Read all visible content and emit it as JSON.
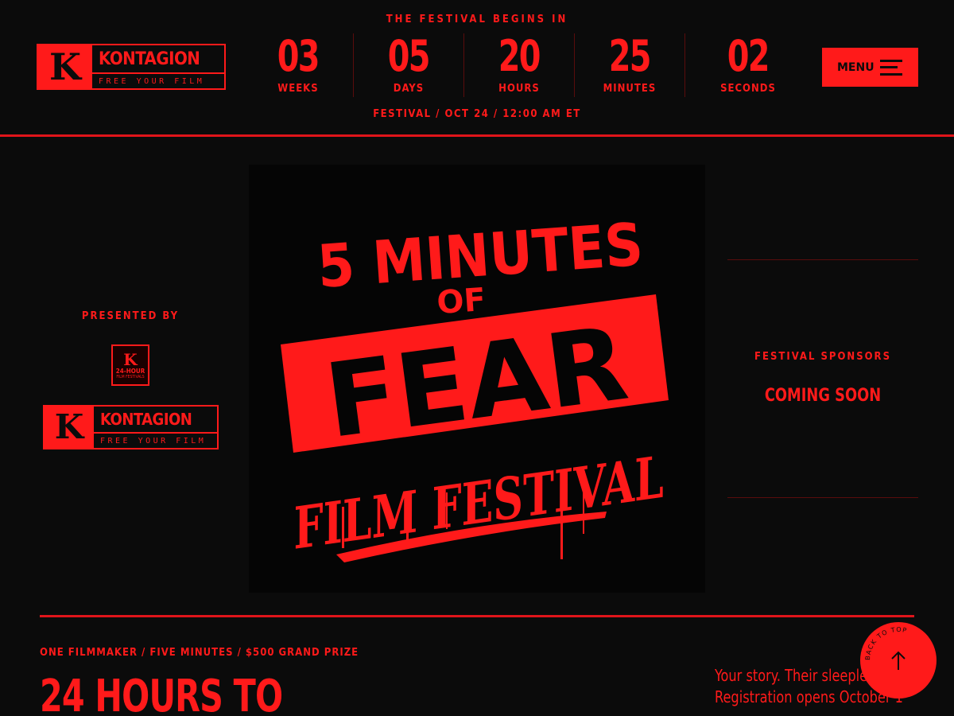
{
  "header": {
    "logo": {
      "letter": "K",
      "name": "KONTAGION",
      "tagline": "FREE YOUR FILM"
    },
    "countdown_title": "THE FESTIVAL BEGINS IN",
    "countdown": [
      {
        "value": "03",
        "label": "WEEKS"
      },
      {
        "value": "05",
        "label": "DAYS"
      },
      {
        "value": "20",
        "label": "HOURS"
      },
      {
        "value": "25",
        "label": "MINUTES"
      },
      {
        "value": "02",
        "label": "SECONDS"
      }
    ],
    "festival_date": "FESTIVAL / OCT 24 / 12:00 AM ET",
    "menu_label": "MENU"
  },
  "presented": {
    "label": "PRESENTED BY",
    "badge": {
      "letter": "K",
      "title": "24-HOUR",
      "subtitle": "FILM FESTIVALS"
    },
    "logo": {
      "letter": "K",
      "name": "KONTAGION",
      "tagline": "FREE YOUR FILM"
    }
  },
  "poster": {
    "line1": "5 MINUTES",
    "line2": "OF",
    "line3": "FEAR",
    "line4": "FILM FESTIVAL"
  },
  "sponsors": {
    "title": "FESTIVAL SPONSORS",
    "status": "COMING SOON"
  },
  "hero": {
    "tagline": "ONE FILMMAKER / FIVE MINUTES / $500 GRAND PRIZE",
    "title": "24 HOURS TO",
    "story_line1": "Your story. Their sleepless night",
    "story_line2": "Registration opens October 1"
  },
  "back_to_top": {
    "label": "BACK TO TOP",
    "icon": "arrow-up-icon"
  },
  "colors": {
    "accent": "#ff1a1a",
    "background": "#0b0b0b"
  }
}
